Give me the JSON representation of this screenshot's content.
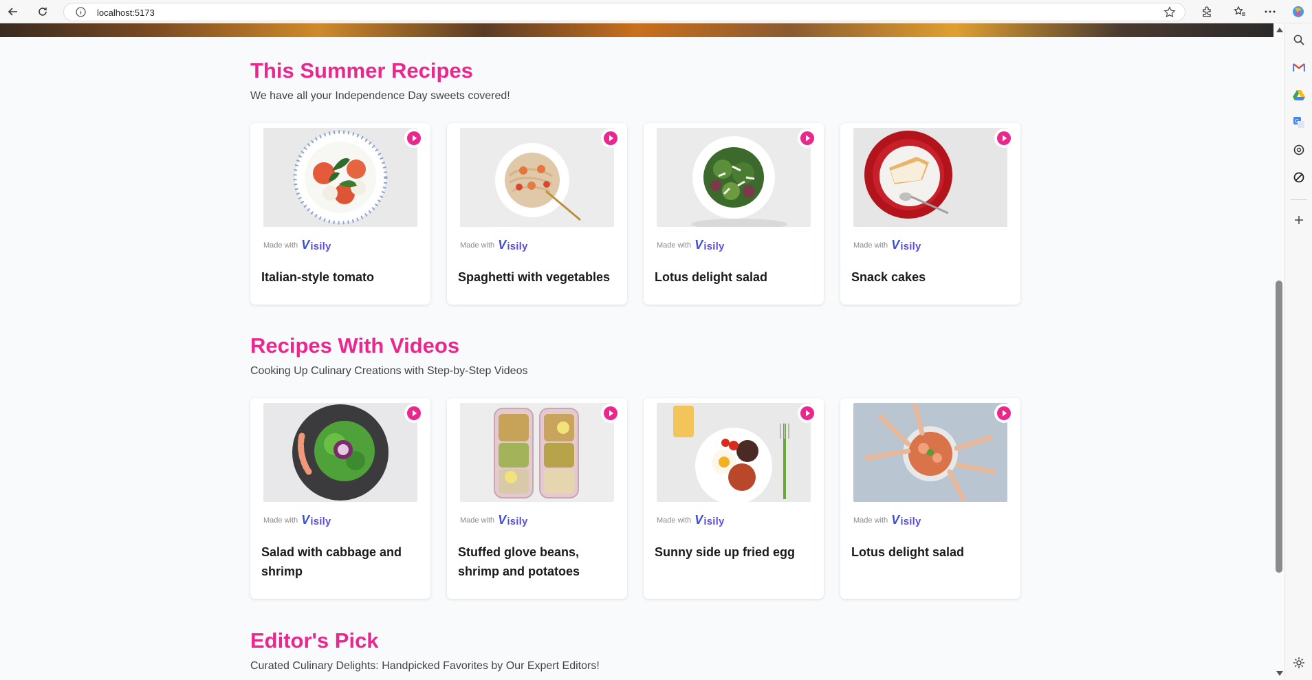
{
  "browser": {
    "url": "localhost:5173"
  },
  "sections": [
    {
      "title": "This Summer Recipes",
      "subtitle": "We have all your Independence Day sweets covered!",
      "cards": [
        {
          "name": "Italian-style tomato",
          "made_with": "Made with",
          "brand": "isily"
        },
        {
          "name": "Spaghetti with vegetables",
          "made_with": "Made with",
          "brand": "isily"
        },
        {
          "name": "Lotus delight salad",
          "made_with": "Made with",
          "brand": "isily"
        },
        {
          "name": "Snack cakes",
          "made_with": "Made with",
          "brand": "isily"
        }
      ]
    },
    {
      "title": "Recipes With Videos",
      "subtitle": "Cooking Up Culinary Creations with Step-by-Step Videos",
      "cards": [
        {
          "name": "Salad with cabbage and shrimp",
          "made_with": "Made with",
          "brand": "isily"
        },
        {
          "name": "Stuffed glove beans, shrimp and potatoes",
          "made_with": "Made with",
          "brand": "isily"
        },
        {
          "name": "Sunny side up fried egg",
          "made_with": "Made with",
          "brand": "isily"
        },
        {
          "name": "Lotus delight salad",
          "made_with": "Made with",
          "brand": "isily"
        }
      ]
    },
    {
      "title": "Editor's Pick",
      "subtitle": "Curated Culinary Delights: Handpicked Favorites by Our Expert Editors!"
    }
  ],
  "colors": {
    "accent": "#ec268f",
    "brand": "#5b4fe0"
  }
}
